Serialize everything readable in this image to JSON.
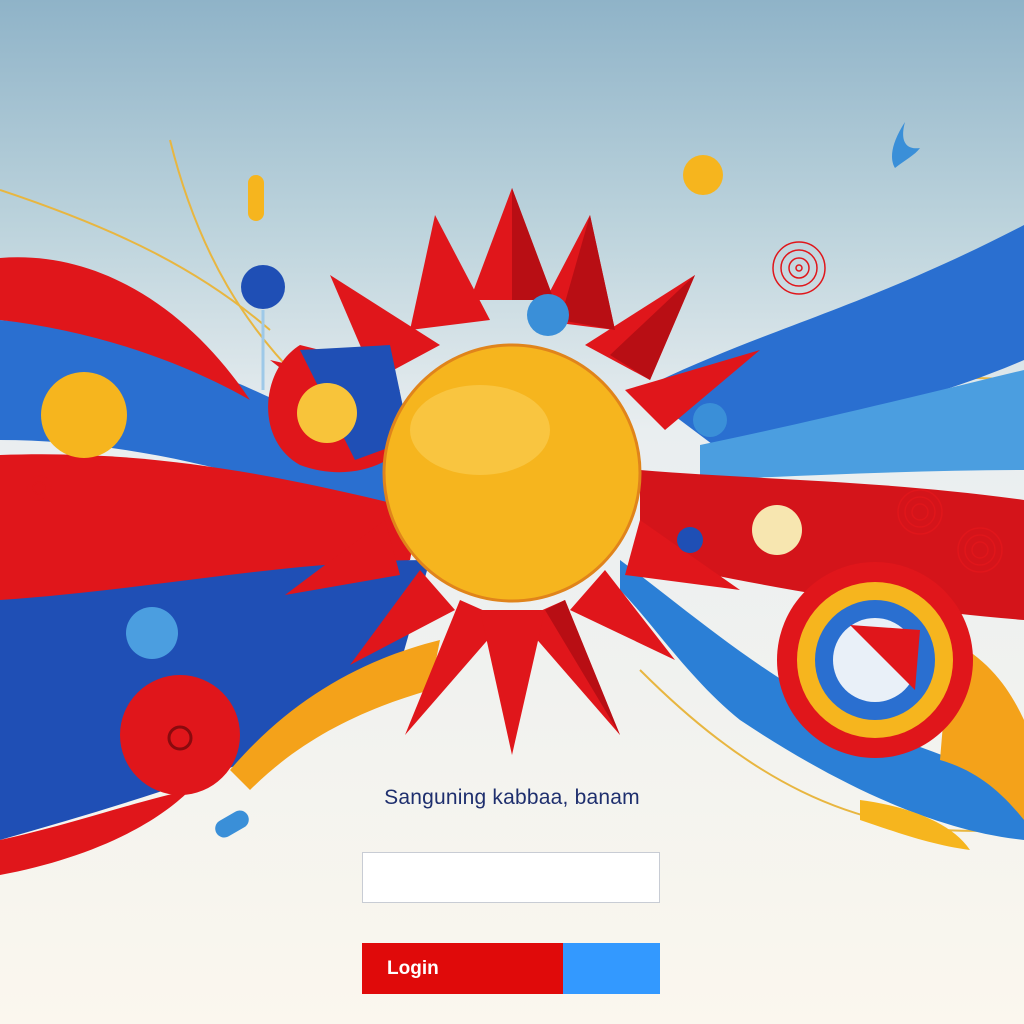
{
  "background": {
    "sky_top": "#8fb3c8",
    "sky_mid": "#e9eef0",
    "floor": "#fbf7ee"
  },
  "palette": {
    "red": "#e0161b",
    "dark_red": "#b80e14",
    "blue": "#1f4fb5",
    "light_blue": "#3a8fd8",
    "yellow": "#f6b51e",
    "orange": "#f4a21a",
    "cream": "#f7e6b0"
  },
  "login": {
    "tagline": "Sanguning kabbaa, banam",
    "tagline_color": "#1e2f6e",
    "username_placeholder": "",
    "username_value": "",
    "button_label": "Login",
    "button_primary_color": "#e00a0a",
    "button_secondary_color": "#3399ff",
    "button_text_color": "#ffffff"
  }
}
